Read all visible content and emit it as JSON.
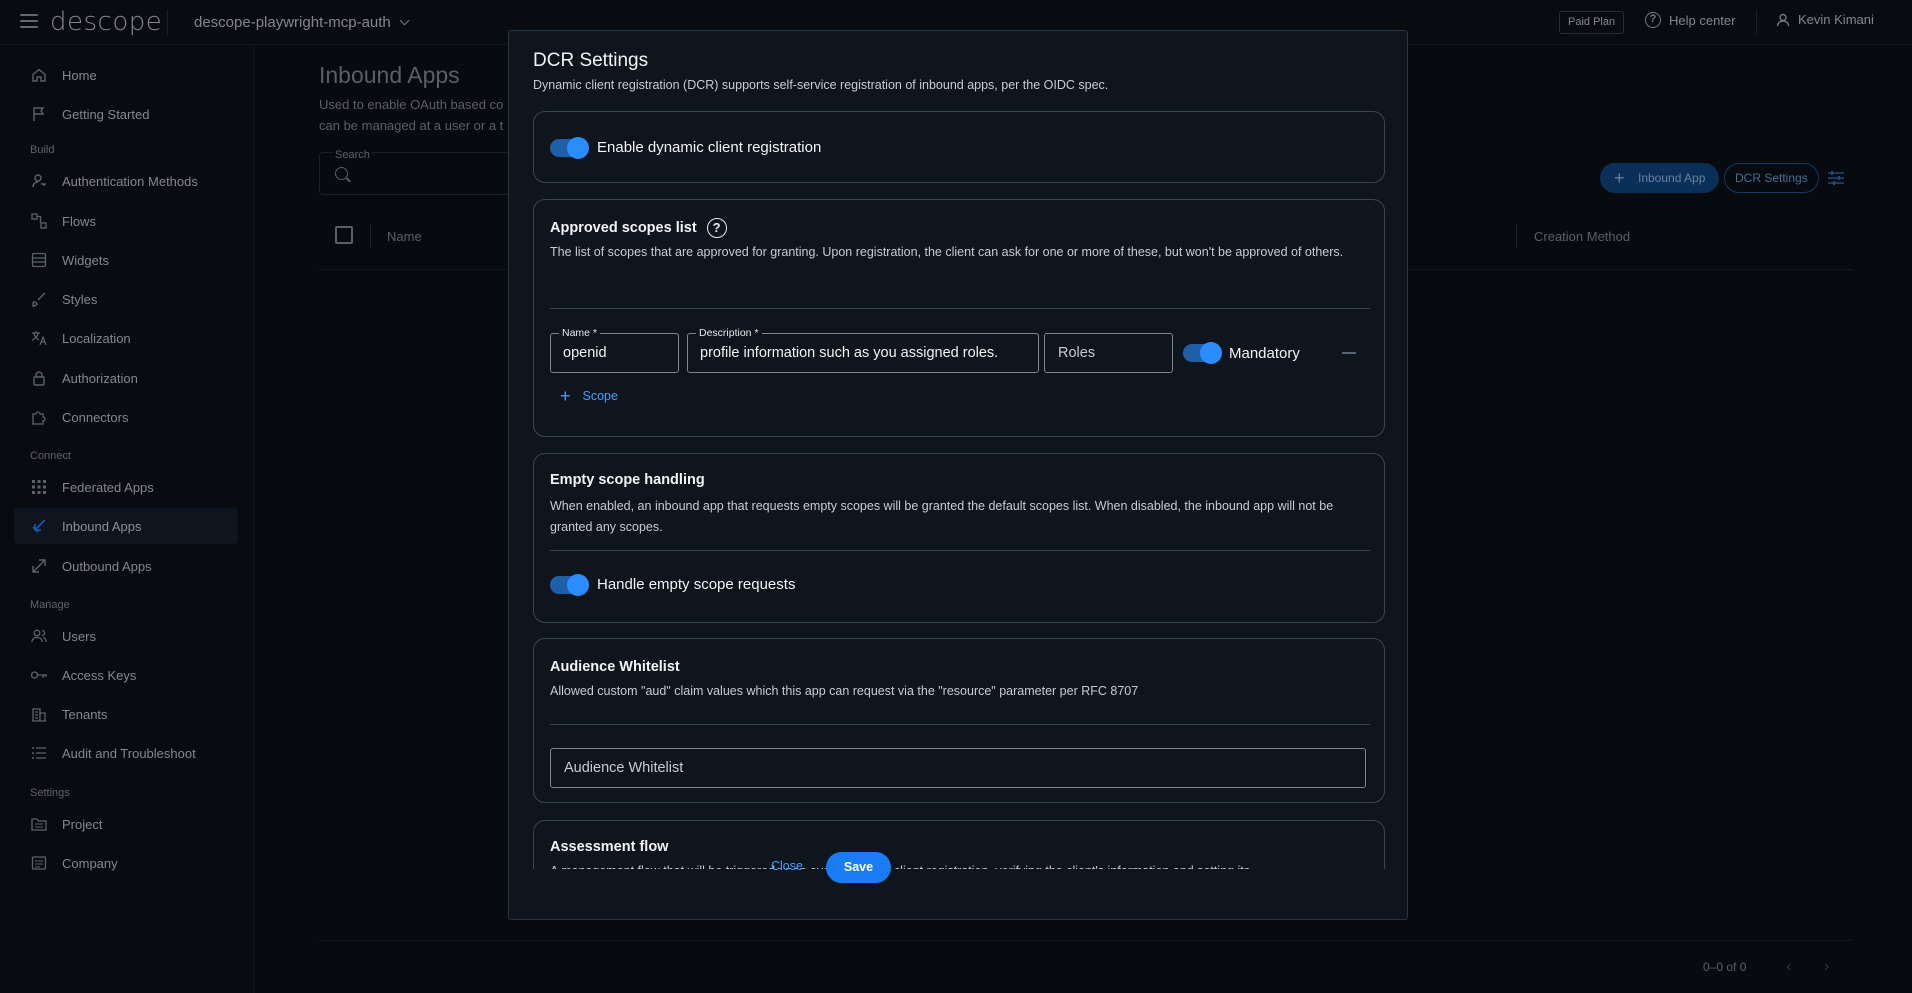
{
  "topbar": {
    "logo_text": "descope",
    "project_name": "descope-playwright-mcp-auth",
    "paid_plan": "Paid Plan",
    "help_center": "Help center",
    "user_name": "Kevin Kimani"
  },
  "sidebar": {
    "items_top": [
      {
        "label": "Home",
        "icon": "home-icon"
      },
      {
        "label": "Getting Started",
        "icon": "flag-icon"
      }
    ],
    "sections": [
      {
        "label": "Build"
      },
      {
        "label": "Connect"
      },
      {
        "label": "Manage"
      },
      {
        "label": "Settings"
      }
    ],
    "build": [
      {
        "label": "Authentication Methods"
      },
      {
        "label": "Flows"
      },
      {
        "label": "Widgets"
      },
      {
        "label": "Styles"
      },
      {
        "label": "Localization"
      },
      {
        "label": "Authorization"
      },
      {
        "label": "Connectors"
      }
    ],
    "connect": [
      {
        "label": "Federated Apps"
      },
      {
        "label": "Inbound Apps",
        "active": true
      },
      {
        "label": "Outbound Apps"
      }
    ],
    "manage": [
      {
        "label": "Users"
      },
      {
        "label": "Access Keys"
      },
      {
        "label": "Tenants"
      },
      {
        "label": "Audit and Troubleshoot"
      }
    ],
    "settings": [
      {
        "label": "Project"
      },
      {
        "label": "Company"
      }
    ]
  },
  "main": {
    "title": "Inbound Apps",
    "desc_line1": "Used to enable OAuth based co",
    "desc_line2": "can be managed at a user or a t",
    "search_label": "Search",
    "btn_inbound": "Inbound App",
    "btn_dcr": "DCR Settings",
    "col_name": "Name",
    "col_creation": "Creation Method",
    "pager_text": "0–0 of 0"
  },
  "modal": {
    "title": "DCR Settings",
    "subtitle": "Dynamic client registration (DCR) supports self-service registration of inbound apps, per the OIDC spec.",
    "enable_dcr": {
      "label": "Enable dynamic client registration",
      "on": true
    },
    "approved_scopes": {
      "title": "Approved scopes list",
      "desc": "The list of scopes that are approved for granting. Upon registration, the client can ask for one or more of these, but won't be approved of others.",
      "name_label": "Name *",
      "name_value": "openid",
      "description_label": "Description *",
      "description_value": "profile information such as you assigned roles.",
      "roles_placeholder": "Roles",
      "mandatory_label": "Mandatory",
      "mandatory_on": true,
      "add_scope": "Scope"
    },
    "empty_scope": {
      "title": "Empty scope handling",
      "desc": "When enabled, an inbound app that requests empty scopes will be granted the default scopes list. When disabled, the inbound app will not be granted any scopes.",
      "toggle_label": "Handle empty scope requests",
      "on": true
    },
    "audience": {
      "title": "Audience Whitelist",
      "desc": "Allowed custom \"aud\" claim values which this app can request via the \"resource\" parameter per RFC 8707",
      "placeholder": "Audience Whitelist"
    },
    "assessment": {
      "title": "Assessment flow",
      "desc": "A management flow that will be triggered upon every dynamic client registration, verifying the client's information and setting its"
    },
    "close": "Close",
    "save": "Save"
  },
  "colors": {
    "accent": "#1a7cf5",
    "background": "#0b1016",
    "modal_bg": "#0f151c"
  }
}
